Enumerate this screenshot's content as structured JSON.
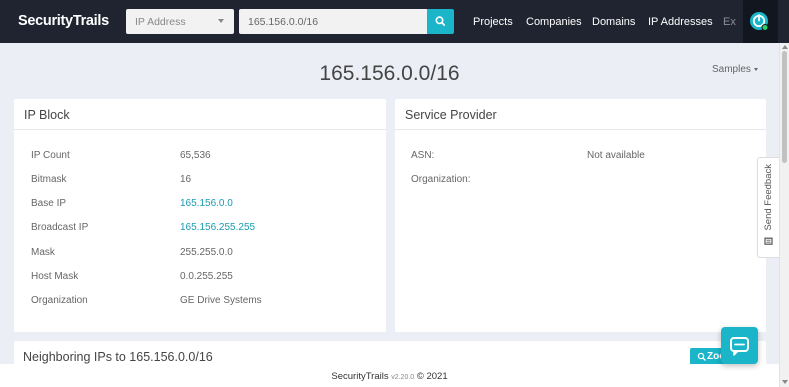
{
  "header": {
    "logo": "SecurityTrails",
    "search_type": "IP Address",
    "search_value": "165.156.0.0/16",
    "nav": [
      {
        "label": "Projects"
      },
      {
        "label": "Companies"
      },
      {
        "label": "Domains"
      },
      {
        "label": "IP Addresses"
      }
    ],
    "nav_cut": "Ex"
  },
  "page": {
    "title": "165.156.0.0/16",
    "samples_label": "Samples"
  },
  "ip_block": {
    "title": "IP Block",
    "rows": [
      {
        "label": "IP Count",
        "value": "65,536"
      },
      {
        "label": "Bitmask",
        "value": "16"
      },
      {
        "label": "Base IP",
        "value": "165.156.0.0"
      },
      {
        "label": "Broadcast IP",
        "value": "165.156.255.255"
      },
      {
        "label": "Mask",
        "value": "255.255.0.0"
      },
      {
        "label": "Host Mask",
        "value": "0.0.255.255"
      },
      {
        "label": "Organization",
        "value": "GE Drive Systems"
      }
    ]
  },
  "service_provider": {
    "title": "Service Provider",
    "rows": [
      {
        "label": "ASN:",
        "value": "Not available"
      },
      {
        "label": "Organization:",
        "value": ""
      }
    ]
  },
  "neighbors": {
    "title": "Neighboring IPs to 165.156.0.0/16",
    "zoom_label": "Zoo"
  },
  "feedback": {
    "label": "Send Feedback"
  },
  "footer": {
    "brand": "SecurityTrails",
    "version": "v2.20.0",
    "copyright": "© 2021"
  },
  "colors": {
    "navbar": "#1f2430",
    "accent": "#1ab5c9",
    "link": "#1a9bb0",
    "background": "#eceef5"
  },
  "icons": {
    "search": "search-icon",
    "user": "power-icon",
    "chat": "chat-icon",
    "feedback": "feedback-icon",
    "zoom": "zoom-icon"
  }
}
